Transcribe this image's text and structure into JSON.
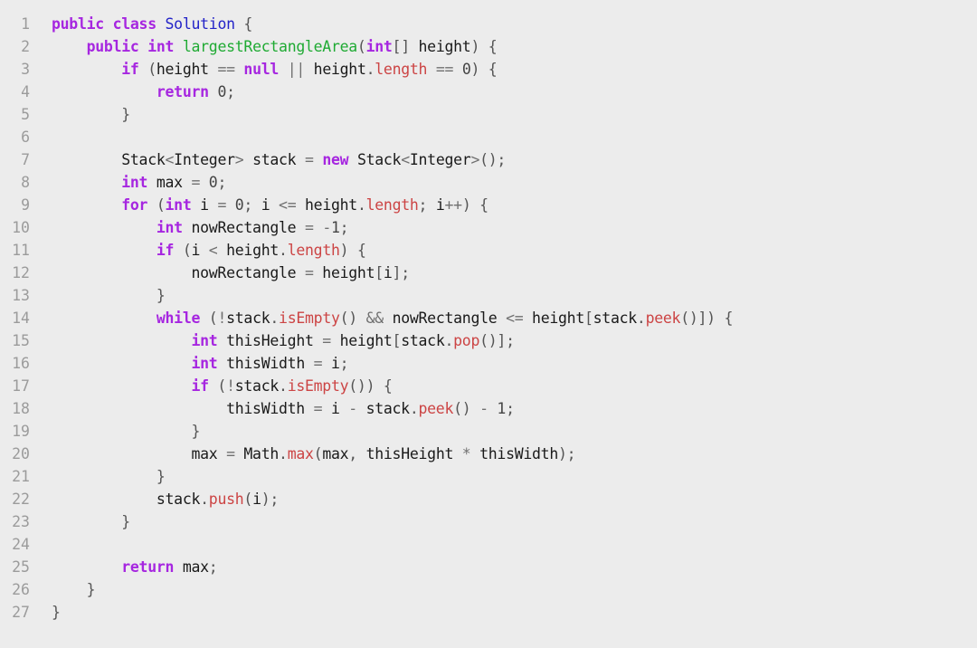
{
  "editor": {
    "language": "java",
    "background_color": "#ececec",
    "gutter_color": "#9b9b9b",
    "default_text_color": "#1a1a1a",
    "total_lines": 27,
    "palette": {
      "keyword": "#a626e0",
      "class_name": "#2323c8",
      "function_name": "#1faa33",
      "member": "#cc4444",
      "operator": "#707070",
      "number": "#444444",
      "plain": "#1a1a1a"
    }
  },
  "code": {
    "lines": [
      {
        "n": "1",
        "tokens": [
          {
            "t": "public",
            "c": "kw"
          },
          {
            "t": " ",
            "c": "pl"
          },
          {
            "t": "class",
            "c": "kw"
          },
          {
            "t": " ",
            "c": "pl"
          },
          {
            "t": "Solution",
            "c": "cls"
          },
          {
            "t": " ",
            "c": "pl"
          },
          {
            "t": "{",
            "c": "punc"
          }
        ]
      },
      {
        "n": "2",
        "tokens": [
          {
            "t": "    ",
            "c": "pl"
          },
          {
            "t": "public",
            "c": "kw"
          },
          {
            "t": " ",
            "c": "pl"
          },
          {
            "t": "int",
            "c": "type"
          },
          {
            "t": " ",
            "c": "pl"
          },
          {
            "t": "largestRectangleArea",
            "c": "fn"
          },
          {
            "t": "(",
            "c": "punc"
          },
          {
            "t": "int",
            "c": "type"
          },
          {
            "t": "[] ",
            "c": "punc"
          },
          {
            "t": "height",
            "c": "pl"
          },
          {
            "t": ") ",
            "c": "punc"
          },
          {
            "t": "{",
            "c": "punc"
          }
        ]
      },
      {
        "n": "3",
        "tokens": [
          {
            "t": "        ",
            "c": "pl"
          },
          {
            "t": "if",
            "c": "kw"
          },
          {
            "t": " (",
            "c": "punc"
          },
          {
            "t": "height",
            "c": "pl"
          },
          {
            "t": " ",
            "c": "pl"
          },
          {
            "t": "==",
            "c": "op"
          },
          {
            "t": " ",
            "c": "pl"
          },
          {
            "t": "null",
            "c": "kw"
          },
          {
            "t": " ",
            "c": "pl"
          },
          {
            "t": "||",
            "c": "op"
          },
          {
            "t": " ",
            "c": "pl"
          },
          {
            "t": "height",
            "c": "pl"
          },
          {
            "t": ".",
            "c": "punc"
          },
          {
            "t": "length",
            "c": "mem"
          },
          {
            "t": " ",
            "c": "pl"
          },
          {
            "t": "==",
            "c": "op"
          },
          {
            "t": " ",
            "c": "pl"
          },
          {
            "t": "0",
            "c": "num"
          },
          {
            "t": ") ",
            "c": "punc"
          },
          {
            "t": "{",
            "c": "punc"
          }
        ]
      },
      {
        "n": "4",
        "tokens": [
          {
            "t": "            ",
            "c": "pl"
          },
          {
            "t": "return",
            "c": "kw"
          },
          {
            "t": " ",
            "c": "pl"
          },
          {
            "t": "0",
            "c": "num"
          },
          {
            "t": ";",
            "c": "punc"
          }
        ]
      },
      {
        "n": "5",
        "tokens": [
          {
            "t": "        ",
            "c": "pl"
          },
          {
            "t": "}",
            "c": "punc"
          }
        ]
      },
      {
        "n": "6",
        "tokens": []
      },
      {
        "n": "7",
        "tokens": [
          {
            "t": "        ",
            "c": "pl"
          },
          {
            "t": "Stack",
            "c": "pl"
          },
          {
            "t": "<",
            "c": "op"
          },
          {
            "t": "Integer",
            "c": "pl"
          },
          {
            "t": ">",
            "c": "op"
          },
          {
            "t": " ",
            "c": "pl"
          },
          {
            "t": "stack",
            "c": "pl"
          },
          {
            "t": " ",
            "c": "pl"
          },
          {
            "t": "=",
            "c": "op"
          },
          {
            "t": " ",
            "c": "pl"
          },
          {
            "t": "new",
            "c": "kw"
          },
          {
            "t": " ",
            "c": "pl"
          },
          {
            "t": "Stack",
            "c": "pl"
          },
          {
            "t": "<",
            "c": "op"
          },
          {
            "t": "Integer",
            "c": "pl"
          },
          {
            "t": ">",
            "c": "op"
          },
          {
            "t": "();",
            "c": "punc"
          }
        ]
      },
      {
        "n": "8",
        "tokens": [
          {
            "t": "        ",
            "c": "pl"
          },
          {
            "t": "int",
            "c": "type"
          },
          {
            "t": " ",
            "c": "pl"
          },
          {
            "t": "max",
            "c": "pl"
          },
          {
            "t": " ",
            "c": "pl"
          },
          {
            "t": "=",
            "c": "op"
          },
          {
            "t": " ",
            "c": "pl"
          },
          {
            "t": "0",
            "c": "num"
          },
          {
            "t": ";",
            "c": "punc"
          }
        ]
      },
      {
        "n": "9",
        "tokens": [
          {
            "t": "        ",
            "c": "pl"
          },
          {
            "t": "for",
            "c": "kw"
          },
          {
            "t": " (",
            "c": "punc"
          },
          {
            "t": "int",
            "c": "type"
          },
          {
            "t": " ",
            "c": "pl"
          },
          {
            "t": "i",
            "c": "pl"
          },
          {
            "t": " ",
            "c": "pl"
          },
          {
            "t": "=",
            "c": "op"
          },
          {
            "t": " ",
            "c": "pl"
          },
          {
            "t": "0",
            "c": "num"
          },
          {
            "t": "; ",
            "c": "punc"
          },
          {
            "t": "i",
            "c": "pl"
          },
          {
            "t": " ",
            "c": "pl"
          },
          {
            "t": "<=",
            "c": "op"
          },
          {
            "t": " ",
            "c": "pl"
          },
          {
            "t": "height",
            "c": "pl"
          },
          {
            "t": ".",
            "c": "punc"
          },
          {
            "t": "length",
            "c": "mem"
          },
          {
            "t": "; ",
            "c": "punc"
          },
          {
            "t": "i",
            "c": "pl"
          },
          {
            "t": "++",
            "c": "op"
          },
          {
            "t": ") ",
            "c": "punc"
          },
          {
            "t": "{",
            "c": "punc"
          }
        ]
      },
      {
        "n": "10",
        "tokens": [
          {
            "t": "            ",
            "c": "pl"
          },
          {
            "t": "int",
            "c": "type"
          },
          {
            "t": " ",
            "c": "pl"
          },
          {
            "t": "nowRectangle",
            "c": "pl"
          },
          {
            "t": " ",
            "c": "pl"
          },
          {
            "t": "=",
            "c": "op"
          },
          {
            "t": " ",
            "c": "pl"
          },
          {
            "t": "-",
            "c": "op"
          },
          {
            "t": "1",
            "c": "num"
          },
          {
            "t": ";",
            "c": "punc"
          }
        ]
      },
      {
        "n": "11",
        "tokens": [
          {
            "t": "            ",
            "c": "pl"
          },
          {
            "t": "if",
            "c": "kw"
          },
          {
            "t": " (",
            "c": "punc"
          },
          {
            "t": "i",
            "c": "pl"
          },
          {
            "t": " ",
            "c": "pl"
          },
          {
            "t": "<",
            "c": "op"
          },
          {
            "t": " ",
            "c": "pl"
          },
          {
            "t": "height",
            "c": "pl"
          },
          {
            "t": ".",
            "c": "punc"
          },
          {
            "t": "length",
            "c": "mem"
          },
          {
            "t": ") ",
            "c": "punc"
          },
          {
            "t": "{",
            "c": "punc"
          }
        ]
      },
      {
        "n": "12",
        "tokens": [
          {
            "t": "                ",
            "c": "pl"
          },
          {
            "t": "nowRectangle",
            "c": "pl"
          },
          {
            "t": " ",
            "c": "pl"
          },
          {
            "t": "=",
            "c": "op"
          },
          {
            "t": " ",
            "c": "pl"
          },
          {
            "t": "height",
            "c": "pl"
          },
          {
            "t": "[",
            "c": "punc"
          },
          {
            "t": "i",
            "c": "pl"
          },
          {
            "t": "];",
            "c": "punc"
          }
        ]
      },
      {
        "n": "13",
        "tokens": [
          {
            "t": "            ",
            "c": "pl"
          },
          {
            "t": "}",
            "c": "punc"
          }
        ]
      },
      {
        "n": "14",
        "tokens": [
          {
            "t": "            ",
            "c": "pl"
          },
          {
            "t": "while",
            "c": "kw"
          },
          {
            "t": " (",
            "c": "punc"
          },
          {
            "t": "!",
            "c": "op"
          },
          {
            "t": "stack",
            "c": "pl"
          },
          {
            "t": ".",
            "c": "punc"
          },
          {
            "t": "isEmpty",
            "c": "mem"
          },
          {
            "t": "() ",
            "c": "punc"
          },
          {
            "t": "&&",
            "c": "op"
          },
          {
            "t": " ",
            "c": "pl"
          },
          {
            "t": "nowRectangle",
            "c": "pl"
          },
          {
            "t": " ",
            "c": "pl"
          },
          {
            "t": "<=",
            "c": "op"
          },
          {
            "t": " ",
            "c": "pl"
          },
          {
            "t": "height",
            "c": "pl"
          },
          {
            "t": "[",
            "c": "punc"
          },
          {
            "t": "stack",
            "c": "pl"
          },
          {
            "t": ".",
            "c": "punc"
          },
          {
            "t": "peek",
            "c": "mem"
          },
          {
            "t": "()]) ",
            "c": "punc"
          },
          {
            "t": "{",
            "c": "punc"
          }
        ]
      },
      {
        "n": "15",
        "tokens": [
          {
            "t": "                ",
            "c": "pl"
          },
          {
            "t": "int",
            "c": "type"
          },
          {
            "t": " ",
            "c": "pl"
          },
          {
            "t": "thisHeight",
            "c": "pl"
          },
          {
            "t": " ",
            "c": "pl"
          },
          {
            "t": "=",
            "c": "op"
          },
          {
            "t": " ",
            "c": "pl"
          },
          {
            "t": "height",
            "c": "pl"
          },
          {
            "t": "[",
            "c": "punc"
          },
          {
            "t": "stack",
            "c": "pl"
          },
          {
            "t": ".",
            "c": "punc"
          },
          {
            "t": "pop",
            "c": "mem"
          },
          {
            "t": "()];",
            "c": "punc"
          }
        ]
      },
      {
        "n": "16",
        "tokens": [
          {
            "t": "                ",
            "c": "pl"
          },
          {
            "t": "int",
            "c": "type"
          },
          {
            "t": " ",
            "c": "pl"
          },
          {
            "t": "thisWidth",
            "c": "pl"
          },
          {
            "t": " ",
            "c": "pl"
          },
          {
            "t": "=",
            "c": "op"
          },
          {
            "t": " ",
            "c": "pl"
          },
          {
            "t": "i",
            "c": "pl"
          },
          {
            "t": ";",
            "c": "punc"
          }
        ]
      },
      {
        "n": "17",
        "tokens": [
          {
            "t": "                ",
            "c": "pl"
          },
          {
            "t": "if",
            "c": "kw"
          },
          {
            "t": " (",
            "c": "punc"
          },
          {
            "t": "!",
            "c": "op"
          },
          {
            "t": "stack",
            "c": "pl"
          },
          {
            "t": ".",
            "c": "punc"
          },
          {
            "t": "isEmpty",
            "c": "mem"
          },
          {
            "t": "()) ",
            "c": "punc"
          },
          {
            "t": "{",
            "c": "punc"
          }
        ]
      },
      {
        "n": "18",
        "tokens": [
          {
            "t": "                    ",
            "c": "pl"
          },
          {
            "t": "thisWidth",
            "c": "pl"
          },
          {
            "t": " ",
            "c": "pl"
          },
          {
            "t": "=",
            "c": "op"
          },
          {
            "t": " ",
            "c": "pl"
          },
          {
            "t": "i",
            "c": "pl"
          },
          {
            "t": " ",
            "c": "pl"
          },
          {
            "t": "-",
            "c": "op"
          },
          {
            "t": " ",
            "c": "pl"
          },
          {
            "t": "stack",
            "c": "pl"
          },
          {
            "t": ".",
            "c": "punc"
          },
          {
            "t": "peek",
            "c": "mem"
          },
          {
            "t": "() ",
            "c": "punc"
          },
          {
            "t": "-",
            "c": "op"
          },
          {
            "t": " ",
            "c": "pl"
          },
          {
            "t": "1",
            "c": "num"
          },
          {
            "t": ";",
            "c": "punc"
          }
        ]
      },
      {
        "n": "19",
        "tokens": [
          {
            "t": "                ",
            "c": "pl"
          },
          {
            "t": "}",
            "c": "punc"
          }
        ]
      },
      {
        "n": "20",
        "tokens": [
          {
            "t": "                ",
            "c": "pl"
          },
          {
            "t": "max",
            "c": "pl"
          },
          {
            "t": " ",
            "c": "pl"
          },
          {
            "t": "=",
            "c": "op"
          },
          {
            "t": " ",
            "c": "pl"
          },
          {
            "t": "Math",
            "c": "pl"
          },
          {
            "t": ".",
            "c": "punc"
          },
          {
            "t": "max",
            "c": "mem"
          },
          {
            "t": "(",
            "c": "punc"
          },
          {
            "t": "max",
            "c": "pl"
          },
          {
            "t": ", ",
            "c": "punc"
          },
          {
            "t": "thisHeight",
            "c": "pl"
          },
          {
            "t": " ",
            "c": "pl"
          },
          {
            "t": "*",
            "c": "op"
          },
          {
            "t": " ",
            "c": "pl"
          },
          {
            "t": "thisWidth",
            "c": "pl"
          },
          {
            "t": ");",
            "c": "punc"
          }
        ]
      },
      {
        "n": "21",
        "tokens": [
          {
            "t": "            ",
            "c": "pl"
          },
          {
            "t": "}",
            "c": "punc"
          }
        ]
      },
      {
        "n": "22",
        "tokens": [
          {
            "t": "            ",
            "c": "pl"
          },
          {
            "t": "stack",
            "c": "pl"
          },
          {
            "t": ".",
            "c": "punc"
          },
          {
            "t": "push",
            "c": "mem"
          },
          {
            "t": "(",
            "c": "punc"
          },
          {
            "t": "i",
            "c": "pl"
          },
          {
            "t": ");",
            "c": "punc"
          }
        ]
      },
      {
        "n": "23",
        "tokens": [
          {
            "t": "        ",
            "c": "pl"
          },
          {
            "t": "}",
            "c": "punc"
          }
        ]
      },
      {
        "n": "24",
        "tokens": []
      },
      {
        "n": "25",
        "tokens": [
          {
            "t": "        ",
            "c": "pl"
          },
          {
            "t": "return",
            "c": "kw"
          },
          {
            "t": " ",
            "c": "pl"
          },
          {
            "t": "max",
            "c": "pl"
          },
          {
            "t": ";",
            "c": "punc"
          }
        ]
      },
      {
        "n": "26",
        "tokens": [
          {
            "t": "    ",
            "c": "pl"
          },
          {
            "t": "}",
            "c": "punc"
          }
        ]
      },
      {
        "n": "27",
        "tokens": [
          {
            "t": "}",
            "c": "punc"
          }
        ]
      }
    ]
  }
}
